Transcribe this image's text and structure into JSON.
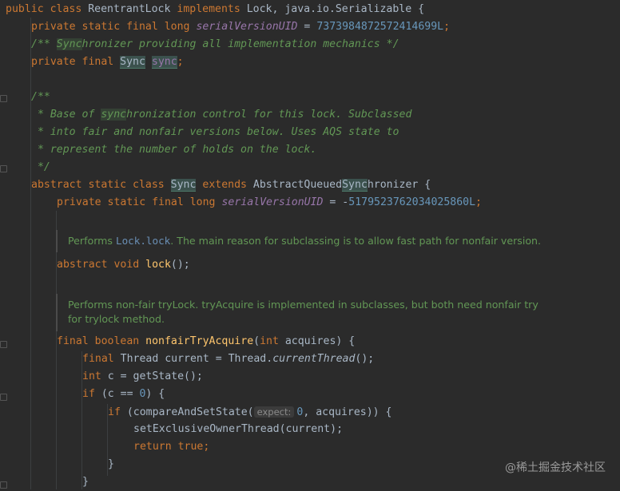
{
  "code": {
    "l1": {
      "kw1": "public class ",
      "cls": "ReentrantLock ",
      "kw2": "implements ",
      "rest": "Lock, java.io.Serializable {"
    },
    "l2": {
      "kw": "private static final long ",
      "field": "serialVersionUID",
      "eq": " = ",
      "num": "7373984872572414699L",
      "semi": ";"
    },
    "l3": {
      "open": "/** ",
      "hl": "Sync",
      "rest": "hronizer providing all implementation mechanics */"
    },
    "l4": {
      "kw": "private final ",
      "type": "Sync",
      "sp": " ",
      "name": "sync",
      "semi": ";"
    },
    "l6": "/**",
    "l7": {
      "pre": " * Base of ",
      "hl": "sync",
      "rest": "hronization control for this lock. Subclassed"
    },
    "l8": " * into fair and nonfair versions below. Uses AQS state to",
    "l9": " * represent the number of holds on the lock.",
    "l10": " */",
    "l11": {
      "kw1": "abstract static class ",
      "name": "Sync",
      "kw2": " extends ",
      "base1": "AbstractQueued",
      "base2": "Sync",
      "base3": "hronizer {"
    },
    "l12": {
      "kw": "private static final long ",
      "field": "serialVersionUID",
      "eq": " = -",
      "num": "5179523762034025860L",
      "semi": ";"
    },
    "doc1": {
      "pre": "Performs ",
      "code": "Lock.lock",
      "rest": ". The main reason for subclassing is to allow fast path for nonfair version."
    },
    "l14": {
      "kw": "abstract void ",
      "fn": "lock",
      "rest": "();"
    },
    "doc2": {
      "line1": "Performs non-fair tryLock. tryAcquire is implemented in subclasses, but both need nonfair try",
      "line2": "for trylock method."
    },
    "l16": {
      "kw": "final boolean ",
      "fn": "nonfairTryAcquire",
      "p1": "(",
      "kw2": "int",
      "rest": " acquires) {"
    },
    "l17": {
      "kw": "final ",
      "t": "Thread current = Thread.",
      "m": "currentThread",
      "rest": "();"
    },
    "l18": {
      "kw": "int ",
      "rest": "c = getState();"
    },
    "l19": {
      "kw": "if ",
      "p": "(c == ",
      "num": "0",
      "rest": ") {"
    },
    "l20": {
      "kw": "if ",
      "p": "(compareAndSetState(",
      "hint": "expect:",
      "num": "0",
      "rest": ", acquires)) {"
    },
    "l21": "setExclusiveOwnerThread(current);",
    "l22": {
      "kw": "return ",
      "val": "true",
      "semi": ";"
    },
    "l23": "}",
    "l24": "}"
  },
  "watermark": "@稀土掘金技术社区"
}
